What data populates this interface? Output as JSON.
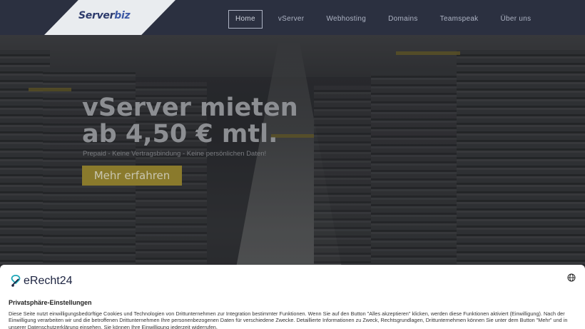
{
  "brand": {
    "logo_part1": "Server",
    "logo_part2": "biz"
  },
  "nav": {
    "items": [
      {
        "label": "Home",
        "active": true
      },
      {
        "label": "vServer",
        "active": false
      },
      {
        "label": "Webhosting",
        "active": false
      },
      {
        "label": "Domains",
        "active": false
      },
      {
        "label": "Teamspeak",
        "active": false
      },
      {
        "label": "Über uns",
        "active": false
      }
    ]
  },
  "hero": {
    "headline_line1": "vServer mieten",
    "headline_line2": "ab 4,50 € mtl.",
    "subline": "Prepaid - Keine Vertragsbindung - Keine persönlichen Daten!",
    "cta_label": "Mehr erfahren"
  },
  "consent": {
    "logo_text": "eRecht24",
    "globe_icon": "globe-icon",
    "title": "Privatsphäre-Einstellungen",
    "text": "Diese Seite nutzt einwilligungsbedürftige Cookies und Technologien von Drittunternehmen zur Integration bestimmter Funktionen. Wenn Sie auf den Button \"Alles akzeptieren\" klicken, werden diese Funktionen aktiviert (Einwilligung). Nach der Einwilligung verarbeiten wir und die betroffenen Drittunternehmen Ihre personenbezogenen Daten für verschiedene Zwecke. Detaillierte Informationen zu Zweck, Rechtsgrundlagen, Drittunternehmen können Sie unter dem Button \"Mehr\" und in unserer Datenschutzerklärung einsehen. Sie können Ihre Einwilligung jederzeit widerrufen."
  },
  "colors": {
    "navbar": "#2b3040",
    "accent": "#8a7a2c",
    "logo_blue": "#2c3a6b"
  }
}
